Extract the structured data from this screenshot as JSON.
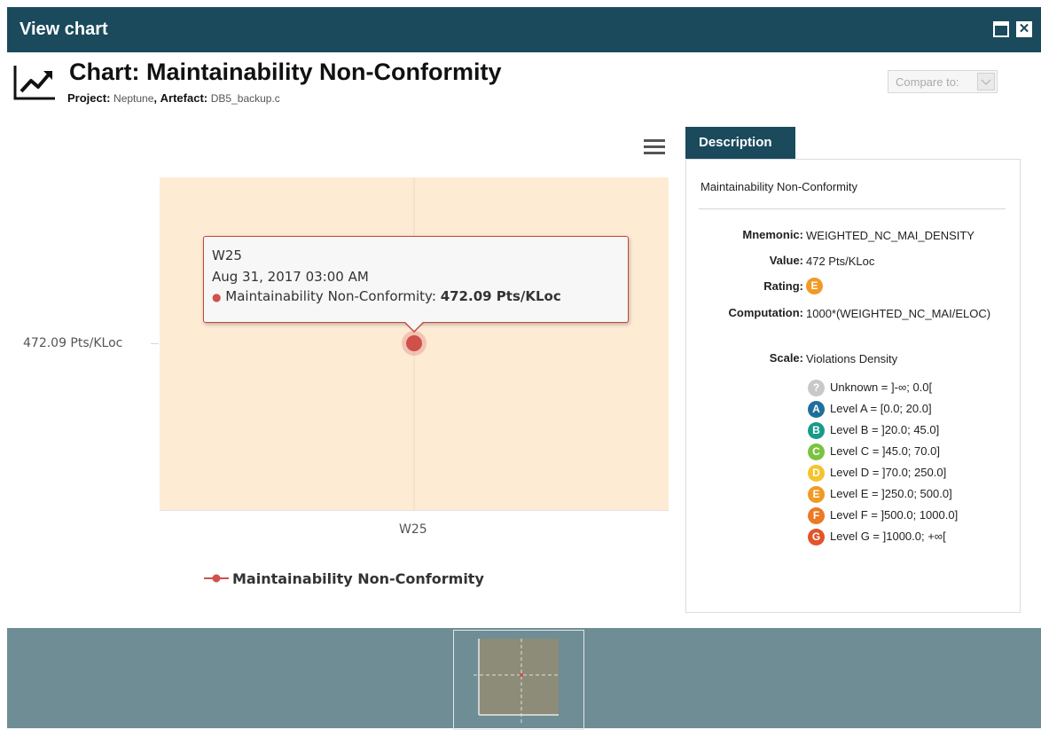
{
  "window": {
    "title": "View chart",
    "maximize_icon": "maximize-icon",
    "close_icon": "close-icon"
  },
  "header": {
    "chart_title": "Chart: Maintainability Non-Conformity",
    "project_label": "Project:",
    "project_value": "Neptune",
    "separator": ",",
    "artefact_label": "Artefact:",
    "artefact_value": "DB5_backup.c",
    "compare_label": "Compare to:"
  },
  "chart_data": {
    "type": "line",
    "categories": [
      "W25"
    ],
    "series": [
      {
        "name": "Maintainability Non-Conformity",
        "values": [
          472.09
        ],
        "color": "#d0504a"
      }
    ],
    "ytick_label": "472.09 Pts/KLoc",
    "xtick_label": "W25",
    "plot_background": "#fdebd4",
    "legend_position": "bottom",
    "tooltip": {
      "line1": "W25",
      "line2": "Aug 31, 2017 03:00 AM",
      "series_label": "Maintainability Non-Conformity:",
      "value": "472.09 Pts/KLoc"
    }
  },
  "description": {
    "tab_label": "Description",
    "name": "Maintainability Non-Conformity",
    "mnemonic_label": "Mnemonic:",
    "mnemonic": "WEIGHTED_NC_MAI_DENSITY",
    "value_label": "Value:",
    "value": "472 Pts/KLoc",
    "rating_label": "Rating:",
    "rating": "E",
    "computation_label": "Computation:",
    "computation": "1000*(WEIGHTED_NC_MAI/ELOC)",
    "scale_label": "Scale:",
    "scale": "Violations Density",
    "levels": [
      {
        "badge": "?",
        "label": "Unknown = ]-∞; 0.0[",
        "color": "#c8c8c8"
      },
      {
        "badge": "A",
        "label": "Level A = [0.0; 20.0]",
        "color": "#1f6f9c"
      },
      {
        "badge": "B",
        "label": "Level B = ]20.0; 45.0]",
        "color": "#1a9a8a"
      },
      {
        "badge": "C",
        "label": "Level C = ]45.0; 70.0]",
        "color": "#7cc242"
      },
      {
        "badge": "D",
        "label": "Level D = ]70.0; 250.0]",
        "color": "#f5c32c"
      },
      {
        "badge": "E",
        "label": "Level E = ]250.0; 500.0]",
        "color": "#f19a24"
      },
      {
        "badge": "F",
        "label": "Level F = ]500.0; 1000.0]",
        "color": "#ea7a24"
      },
      {
        "badge": "G",
        "label": "Level G = ]1000.0; +∞[",
        "color": "#e2542a"
      }
    ]
  }
}
